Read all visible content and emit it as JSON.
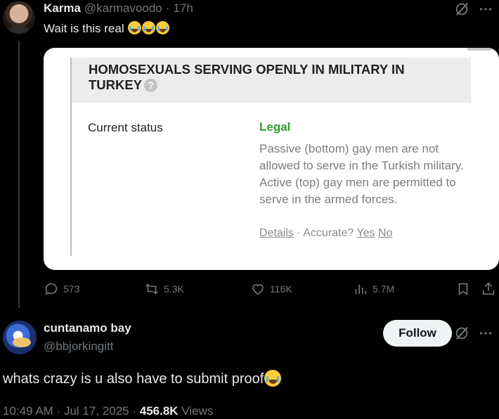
{
  "tweet1": {
    "name": "Karma",
    "handle": "@karmavoodo",
    "separator": "·",
    "time": "17h",
    "text": "Wait is this real",
    "emojis": [
      "loudly-crying-face",
      "loudly-crying-face",
      "loudly-crying-face"
    ],
    "media": {
      "heading": "HOMOSEXUALS SERVING OPENLY IN MILITARY IN TURKEY",
      "status_label": "Current status",
      "status_value": "Legal",
      "status_description": "Passive (bottom) gay men are not allowed to serve in the Turkish military. Active (top) gay men are permitted to serve in the armed forces.",
      "details_link": "Details",
      "dot": "·",
      "accurate_label": "Accurate?",
      "yes_link": "Yes",
      "no_link": "No",
      "status_color": "#319e2e"
    },
    "actions": {
      "replies": "573",
      "reposts": "5.3K",
      "likes": "116K",
      "views": "5.7M"
    }
  },
  "tweet2": {
    "name": "cuntanamo bay",
    "handle": "@bbjorkingitt",
    "follow_label": "Follow",
    "text": "whats crazy is u also have to submit proof",
    "emoji": "loudly-crying-face",
    "time": "10:49 AM",
    "sep1": "·",
    "date": "Jul 17, 2025",
    "sep2": "·",
    "views_count": "456.8K",
    "views_label": "Views"
  },
  "icons": [
    "grok-icon",
    "more-icon",
    "reply-icon",
    "repost-icon",
    "like-icon",
    "views-icon",
    "bookmark-icon",
    "share-icon",
    "help-icon"
  ]
}
